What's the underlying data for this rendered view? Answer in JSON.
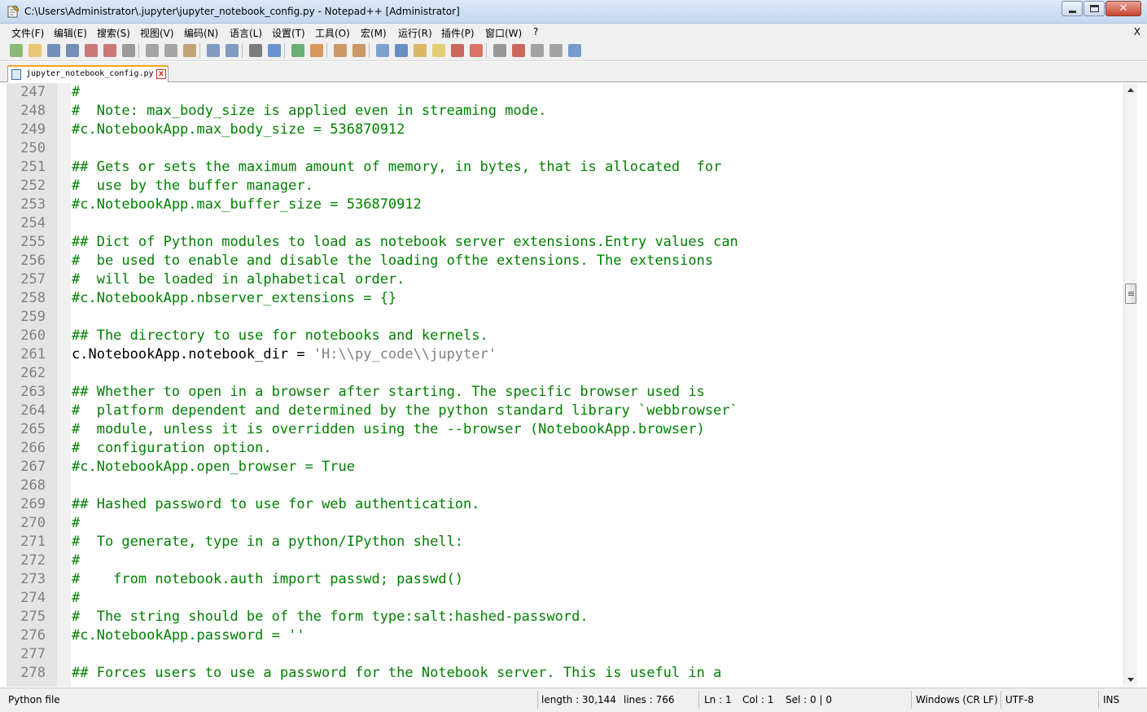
{
  "window": {
    "title": "C:\\Users\\Administrator\\.jupyter\\jupyter_notebook_config.py - Notepad++ [Administrator]",
    "close_glyph": "✕"
  },
  "menu": {
    "items": [
      "文件(F)",
      "编辑(E)",
      "搜索(S)",
      "视图(V)",
      "编码(N)",
      "语言(L)",
      "设置(T)",
      "工具(O)",
      "宏(M)",
      "运行(R)",
      "插件(P)",
      "窗口(W)",
      "?"
    ],
    "close_label": "X"
  },
  "toolbar": {
    "icons": [
      "new-file-icon",
      "open-file-icon",
      "save-icon",
      "save-all-icon",
      "close-icon",
      "close-all-icon",
      "print-icon",
      "cut-icon",
      "copy-icon",
      "paste-icon",
      "undo-icon",
      "redo-icon",
      "find-icon",
      "replace-icon",
      "zoom-in-icon",
      "zoom-out-icon",
      "sync-vertical-icon",
      "sync-horizontal-icon",
      "word-wrap-icon",
      "show-all-chars-icon",
      "indent-guide-icon",
      "user-language-icon",
      "doc-map-icon",
      "function-list-icon",
      "folder-workspace-icon",
      "monitoring-icon",
      "record-macro-icon",
      "stop-record-icon",
      "play-macro-icon",
      "run-macro-multiple-icon",
      "save-macro-icon"
    ]
  },
  "tab": {
    "label": "jupyter_notebook_config.py",
    "close_glyph": "x"
  },
  "editor": {
    "lines": [
      {
        "n": "247",
        "text": "#",
        "kind": "comment"
      },
      {
        "n": "248",
        "text": "#  Note: max_body_size is applied even in streaming mode.",
        "kind": "comment"
      },
      {
        "n": "249",
        "text": "#c.NotebookApp.max_body_size = 536870912",
        "kind": "comment"
      },
      {
        "n": "250",
        "text": "",
        "kind": "comment"
      },
      {
        "n": "251",
        "text": "## Gets or sets the maximum amount of memory, in bytes, that is allocated  for",
        "kind": "comment"
      },
      {
        "n": "252",
        "text": "#  use by the buffer manager.",
        "kind": "comment"
      },
      {
        "n": "253",
        "text": "#c.NotebookApp.max_buffer_size = 536870912",
        "kind": "comment"
      },
      {
        "n": "254",
        "text": "",
        "kind": "comment"
      },
      {
        "n": "255",
        "text": "## Dict of Python modules to load as notebook server extensions.Entry values can",
        "kind": "comment"
      },
      {
        "n": "256",
        "text": "#  be used to enable and disable the loading ofthe extensions. The extensions",
        "kind": "comment"
      },
      {
        "n": "257",
        "text": "#  will be loaded in alphabetical order.",
        "kind": "comment"
      },
      {
        "n": "258",
        "text": "#c.NotebookApp.nbserver_extensions = {}",
        "kind": "comment"
      },
      {
        "n": "259",
        "text": "",
        "kind": "comment"
      },
      {
        "n": "260",
        "text": "## The directory to use for notebooks and kernels.",
        "kind": "comment"
      },
      {
        "n": "261",
        "text": "c.NotebookApp.notebook_dir = ",
        "kind": "plain",
        "str": "'H:\\\\py_code\\\\jupyter'"
      },
      {
        "n": "262",
        "text": "",
        "kind": "comment"
      },
      {
        "n": "263",
        "text": "## Whether to open in a browser after starting. The specific browser used is",
        "kind": "comment"
      },
      {
        "n": "264",
        "text": "#  platform dependent and determined by the python standard library `webbrowser`",
        "kind": "comment"
      },
      {
        "n": "265",
        "text": "#  module, unless it is overridden using the --browser (NotebookApp.browser)",
        "kind": "comment"
      },
      {
        "n": "266",
        "text": "#  configuration option.",
        "kind": "comment"
      },
      {
        "n": "267",
        "text": "#c.NotebookApp.open_browser = True",
        "kind": "comment"
      },
      {
        "n": "268",
        "text": "",
        "kind": "comment"
      },
      {
        "n": "269",
        "text": "## Hashed password to use for web authentication.",
        "kind": "comment"
      },
      {
        "n": "270",
        "text": "#",
        "kind": "comment"
      },
      {
        "n": "271",
        "text": "#  To generate, type in a python/IPython shell:",
        "kind": "comment"
      },
      {
        "n": "272",
        "text": "#",
        "kind": "comment"
      },
      {
        "n": "273",
        "text": "#    from notebook.auth import passwd; passwd()",
        "kind": "comment"
      },
      {
        "n": "274",
        "text": "#",
        "kind": "comment"
      },
      {
        "n": "275",
        "text": "#  The string should be of the form type:salt:hashed-password.",
        "kind": "comment"
      },
      {
        "n": "276",
        "text": "#c.NotebookApp.password = ''",
        "kind": "comment"
      },
      {
        "n": "277",
        "text": "",
        "kind": "comment"
      },
      {
        "n": "278",
        "text": "## Forces users to use a password for the Notebook server. This is useful in a",
        "kind": "comment"
      }
    ]
  },
  "status": {
    "language": "Python file",
    "length": "length : 30,144",
    "lines": "lines : 766",
    "ln": "Ln : 1",
    "col": "Col : 1",
    "sel": "Sel : 0 | 0",
    "eol": "Windows (CR LF)",
    "encoding": "UTF-8",
    "mode": "INS"
  },
  "colors": {
    "comment": "#008000",
    "string": "#808080",
    "gutter_bg": "#e4e4e4",
    "line_number": "#808080"
  }
}
